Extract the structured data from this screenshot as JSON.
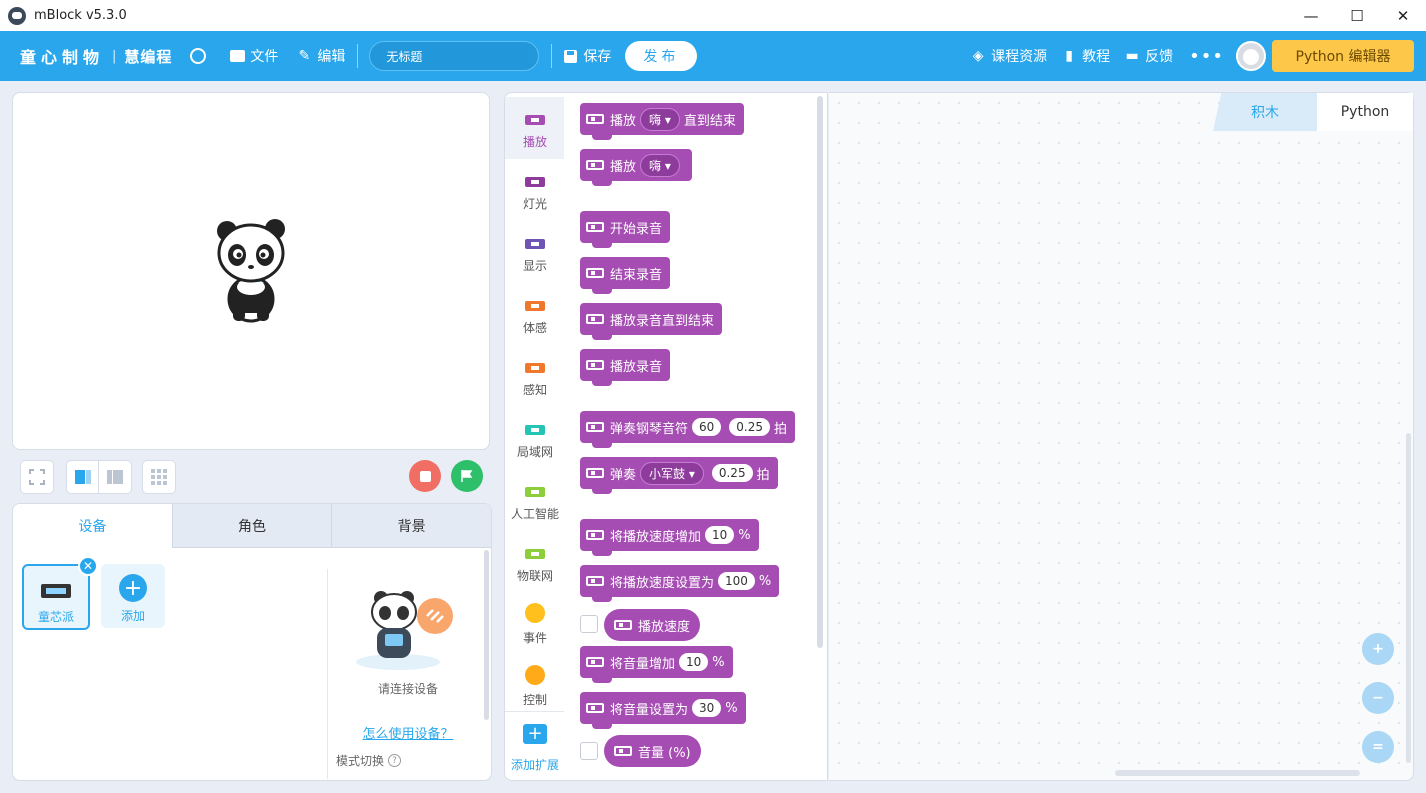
{
  "window": {
    "title": "mBlock v5.3.0",
    "minimize": "—",
    "maximize": "☐",
    "close": "✕"
  },
  "toolbar": {
    "brand": "童心制物",
    "separator": "|",
    "brand2": "慧编程",
    "language_icon": "globe-icon",
    "file_label": "文件",
    "edit_label": "编辑",
    "project_name": "无标题",
    "save_label": "保存",
    "publish_label": "发布",
    "course_label": "课程资源",
    "tutorial_label": "教程",
    "feedback_label": "反馈",
    "more_label": "•••",
    "python_editor_label": "Python 编辑器"
  },
  "colors": {
    "accent": "#2aa7ec",
    "sound_block": "#a64db3",
    "python_button": "#fdc74a",
    "stop": "#f06e63",
    "go": "#2ebf6b"
  },
  "device_panel": {
    "tabs": [
      {
        "label": "设备",
        "active": true
      },
      {
        "label": "角色",
        "active": false
      },
      {
        "label": "背景",
        "active": false
      }
    ],
    "device_name": "童芯派",
    "add_label": "添加",
    "connect_message": "请连接设备",
    "howto_link": "怎么使用设备？",
    "mode_switch_label": "模式切换",
    "help_glyph": "?"
  },
  "categories": [
    {
      "label": "播放",
      "color": "#a64db3",
      "shape": "rect",
      "active": true
    },
    {
      "label": "灯光",
      "color": "#8e3c9c",
      "shape": "rect",
      "active": false
    },
    {
      "label": "显示",
      "color": "#6f54b6",
      "shape": "rect",
      "active": false
    },
    {
      "label": "体感",
      "color": "#f0772e",
      "shape": "rect",
      "active": false
    },
    {
      "label": "感知",
      "color": "#f0772e",
      "shape": "rect",
      "active": false
    },
    {
      "label": "局域网",
      "color": "#25c5b6",
      "shape": "rect",
      "active": false
    },
    {
      "label": "人工智能",
      "color": "#8ccf3b",
      "shape": "rect",
      "active": false
    },
    {
      "label": "物联网",
      "color": "#8ccf3b",
      "shape": "rect",
      "active": false
    },
    {
      "label": "事件",
      "color": "#ffbf1c",
      "shape": "dot",
      "active": false
    },
    {
      "label": "控制",
      "color": "#ffab19",
      "shape": "dot",
      "active": false
    }
  ],
  "extension_label": "添加扩展",
  "blocks": {
    "b1": {
      "pre": "播放",
      "drop": "嗨 ▾",
      "post": "直到结束"
    },
    "b2": {
      "pre": "播放",
      "drop": "嗨 ▾"
    },
    "b3": {
      "pre": "开始录音"
    },
    "b4": {
      "pre": "结束录音"
    },
    "b5": {
      "pre": "播放录音直到结束"
    },
    "b6": {
      "pre": "播放录音"
    },
    "b7": {
      "pre": "弹奏钢琴音符",
      "v1": "60",
      "v2": "0.25",
      "post": "拍"
    },
    "b8": {
      "pre": "弹奏",
      "drop": "小军鼓 ▾",
      "v1": "0.25",
      "post": "拍"
    },
    "b9": {
      "pre": "将播放速度增加",
      "v1": "10",
      "post": "%"
    },
    "b10": {
      "pre": "将播放速度设置为",
      "v1": "100",
      "post": "%"
    },
    "b11": {
      "pre": "播放速度"
    },
    "b12": {
      "pre": "将音量增加",
      "v1": "10",
      "post": "%"
    },
    "b13": {
      "pre": "将音量设置为",
      "v1": "30",
      "post": "%"
    },
    "b14": {
      "pre": "音量 (%)"
    }
  },
  "workspace": {
    "tab_blocks": "积木",
    "tab_python": "Python",
    "zoom_in": "+",
    "zoom_out": "−",
    "zoom_reset": "="
  }
}
